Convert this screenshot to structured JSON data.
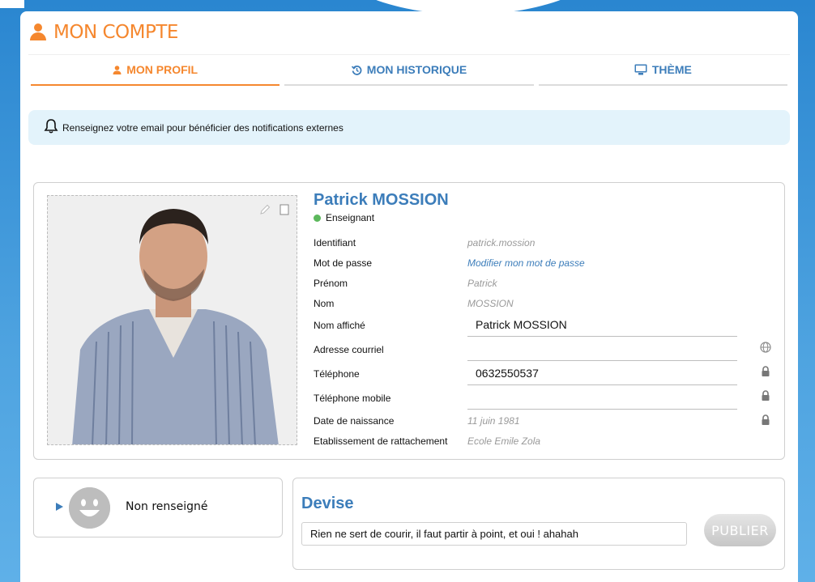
{
  "page": {
    "title": "MON COMPTE"
  },
  "tabs": [
    {
      "label": "MON PROFIL",
      "icon": "user-icon",
      "active": true
    },
    {
      "label": "MON HISTORIQUE",
      "icon": "history-icon",
      "active": false
    },
    {
      "label": "THÈME",
      "icon": "monitor-icon",
      "active": false
    }
  ],
  "notification": {
    "text": "Renseignez votre email pour bénéficier des notifications externes",
    "icon": "bell-icon"
  },
  "profile": {
    "name": "Patrick MOSSION",
    "role": "Enseignant",
    "role_color": "#5cb85c",
    "fields": {
      "identifiant": {
        "label": "Identifiant",
        "value": "patrick.mossion"
      },
      "password": {
        "label": "Mot de passe",
        "link": "Modifier mon mot de passe"
      },
      "prenom": {
        "label": "Prénom",
        "value": "Patrick"
      },
      "nom": {
        "label": "Nom",
        "value": "MOSSION"
      },
      "nom_affiche": {
        "label": "Nom affiché",
        "value": "Patrick MOSSION"
      },
      "email": {
        "label": "Adresse courriel",
        "value": ""
      },
      "telephone": {
        "label": "Téléphone",
        "value": "0632550537"
      },
      "mobile": {
        "label": "Téléphone mobile",
        "value": ""
      },
      "naissance": {
        "label": "Date de naissance",
        "value": "11 juin 1981"
      },
      "etablissement": {
        "label": "Etablissement de rattachement",
        "value": "Ecole Emile Zola"
      }
    },
    "side_icons": [
      "globe-icon",
      "lock-icon",
      "lock-icon",
      "lock-icon"
    ]
  },
  "mood": {
    "label": "Non renseigné",
    "icon": "smiley-icon"
  },
  "devise": {
    "title": "Devise",
    "value": "Rien ne sert de courir, il faut partir à point, et oui ! ahahah",
    "button": "PUBLIER"
  },
  "colors": {
    "accent_orange": "#f5872e",
    "accent_blue": "#3c7dba",
    "notif_bg": "#e3f3fb"
  }
}
